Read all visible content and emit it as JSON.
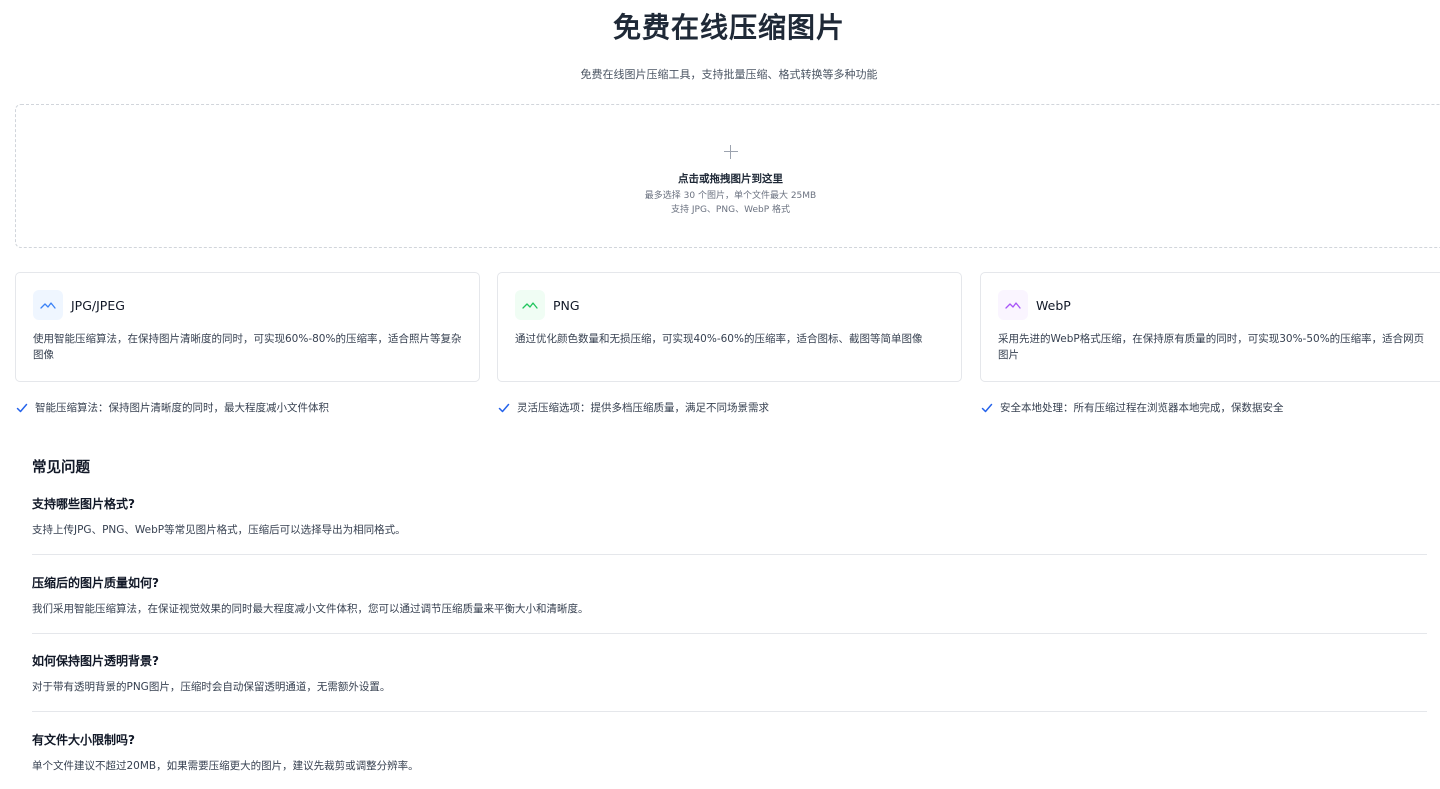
{
  "header": {
    "title": "免费在线压缩图片",
    "subtitle": "免费在线图片压缩工具，支持批量压缩、格式转换等多种功能"
  },
  "upload": {
    "title": "点击或拖拽图片到这里",
    "hint_limit": "最多选择 30 个图片，单个文件最大 25MB",
    "hint_formats": "支持 JPG、PNG、WebP 格式"
  },
  "formats": [
    {
      "name": "JPG/JPEG",
      "icon": "mountain-icon",
      "icon_color": "#3b82f6",
      "icon_bg": "#eff6ff",
      "description": "使用智能压缩算法，在保持图片清晰度的同时，可实现60%-80%的压缩率，适合照片等复杂图像"
    },
    {
      "name": "PNG",
      "icon": "mountain-icon",
      "icon_color": "#22c55e",
      "icon_bg": "#f0fdf4",
      "description": "通过优化颜色数量和无损压缩，可实现40%-60%的压缩率，适合图标、截图等简单图像"
    },
    {
      "name": "WebP",
      "icon": "mountain-icon",
      "icon_color": "#a855f7",
      "icon_bg": "#faf5ff",
      "description": "采用先进的WebP格式压缩，在保持原有质量的同时，可实现30%-50%的压缩率，适合网页图片"
    }
  ],
  "features": [
    {
      "text": "智能压缩算法：保持图片清晰度的同时，最大程度减小文件体积"
    },
    {
      "text": "灵活压缩选项：提供多档压缩质量，满足不同场景需求"
    },
    {
      "text": "安全本地处理：所有压缩过程在浏览器本地完成，保数据安全"
    }
  ],
  "colors": {
    "check": "#2563eb",
    "border": "#e5e7eb"
  },
  "faq": {
    "heading": "常见问题",
    "items": [
      {
        "q": "支持哪些图片格式?",
        "a": "支持上传JPG、PNG、WebP等常见图片格式，压缩后可以选择导出为相同格式。"
      },
      {
        "q": "压缩后的图片质量如何?",
        "a": "我们采用智能压缩算法，在保证视觉效果的同时最大程度减小文件体积，您可以通过调节压缩质量来平衡大小和清晰度。"
      },
      {
        "q": "如何保持图片透明背景?",
        "a": "对于带有透明背景的PNG图片，压缩时会自动保留透明通道，无需额外设置。"
      },
      {
        "q": "有文件大小限制吗?",
        "a": "单个文件建议不超过20MB，如果需要压缩更大的图片，建议先裁剪或调整分辨率。"
      }
    ]
  }
}
